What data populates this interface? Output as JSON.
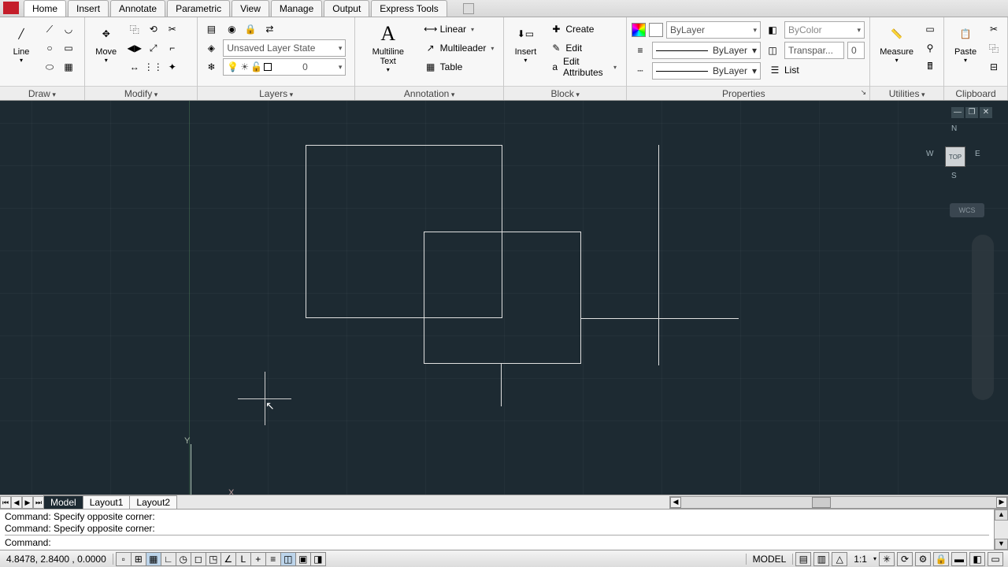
{
  "tabs": {
    "home": "Home",
    "insert": "Insert",
    "annotate": "Annotate",
    "parametric": "Parametric",
    "view": "View",
    "manage": "Manage",
    "output": "Output",
    "express": "Express Tools"
  },
  "ribbon": {
    "draw": {
      "title": "Draw",
      "line": "Line"
    },
    "modify": {
      "title": "Modify",
      "move": "Move"
    },
    "layers": {
      "title": "Layers",
      "state": "Unsaved Layer State",
      "current": "0"
    },
    "annotation": {
      "title": "Annotation",
      "mtext": "Multiline Text",
      "linear": "Linear",
      "mleader": "Multileader",
      "table": "Table"
    },
    "block": {
      "title": "Block",
      "insert": "Insert",
      "create": "Create",
      "edit": "Edit",
      "editattr": "Edit Attributes"
    },
    "properties": {
      "title": "Properties",
      "bylayer": "ByLayer",
      "bycolor": "ByColor",
      "transp": "Transpar...",
      "transpval": "0",
      "list": "List"
    },
    "utilities": {
      "title": "Utilities",
      "measure": "Measure"
    },
    "clipboard": {
      "title": "Clipboard",
      "paste": "Paste"
    }
  },
  "viewcube": {
    "top": "TOP",
    "n": "N",
    "s": "S",
    "e": "E",
    "w": "W",
    "wcs": "WCS"
  },
  "model_tabs": {
    "model": "Model",
    "l1": "Layout1",
    "l2": "Layout2"
  },
  "command": {
    "line1": "Command: Specify opposite corner:",
    "line2": "Command: Specify opposite corner:",
    "prompt": "Command:"
  },
  "status": {
    "coords": "4.8478, 2.8400 , 0.0000",
    "model": "MODEL",
    "scale": "1:1"
  },
  "ucs": {
    "x": "X",
    "y": "Y"
  }
}
